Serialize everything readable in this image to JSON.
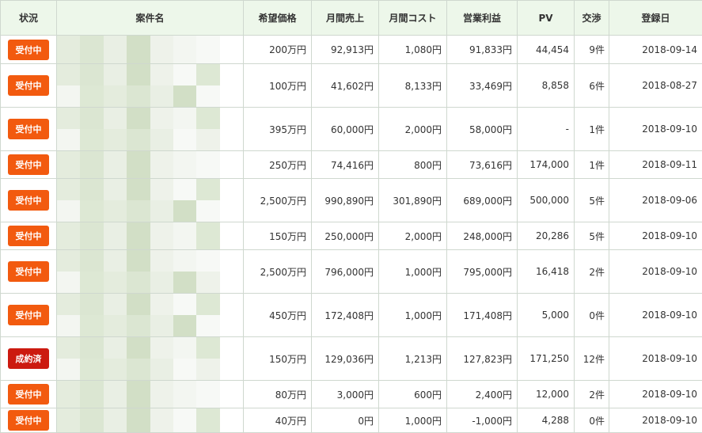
{
  "columns": [
    "状況",
    "案件名",
    "希望価格",
    "月間売上",
    "月間コスト",
    "営業利益",
    "PV",
    "交渉",
    "登録日"
  ],
  "colors": {
    "header_bg": "#edf7ea",
    "grid": "#cfd8cf",
    "status_open": "#f25a0f",
    "status_closed": "#cc1a10"
  },
  "rows": [
    {
      "status": "受付中",
      "status_type": "open",
      "price": "200万円",
      "sales": "92,913円",
      "cost": "1,080円",
      "profit": "91,833円",
      "pv": "44,454",
      "negotiations": "9件",
      "date": "2018-09-14"
    },
    {
      "status": "受付中",
      "status_type": "open",
      "price": "100万円",
      "sales": "41,602円",
      "cost": "8,133円",
      "profit": "33,469円",
      "pv": "8,858",
      "negotiations": "6件",
      "date": "2018-08-27"
    },
    {
      "status": "受付中",
      "status_type": "open",
      "price": "395万円",
      "sales": "60,000円",
      "cost": "2,000円",
      "profit": "58,000円",
      "pv": "-",
      "negotiations": "1件",
      "date": "2018-09-10"
    },
    {
      "status": "受付中",
      "status_type": "open",
      "price": "250万円",
      "sales": "74,416円",
      "cost": "800円",
      "profit": "73,616円",
      "pv": "174,000",
      "negotiations": "1件",
      "date": "2018-09-11"
    },
    {
      "status": "受付中",
      "status_type": "open",
      "price": "2,500万円",
      "sales": "990,890円",
      "cost": "301,890円",
      "profit": "689,000円",
      "pv": "500,000",
      "negotiations": "5件",
      "date": "2018-09-06"
    },
    {
      "status": "受付中",
      "status_type": "open",
      "price": "150万円",
      "sales": "250,000円",
      "cost": "2,000円",
      "profit": "248,000円",
      "pv": "20,286",
      "negotiations": "5件",
      "date": "2018-09-10"
    },
    {
      "status": "受付中",
      "status_type": "open",
      "price": "2,500万円",
      "sales": "796,000円",
      "cost": "1,000円",
      "profit": "795,000円",
      "pv": "16,418",
      "negotiations": "2件",
      "date": "2018-09-10"
    },
    {
      "status": "受付中",
      "status_type": "open",
      "price": "450万円",
      "sales": "172,408円",
      "cost": "1,000円",
      "profit": "171,408円",
      "pv": "5,000",
      "negotiations": "0件",
      "date": "2018-09-10"
    },
    {
      "status": "成約済",
      "status_type": "closed",
      "price": "150万円",
      "sales": "129,036円",
      "cost": "1,213円",
      "profit": "127,823円",
      "pv": "171,250",
      "negotiations": "12件",
      "date": "2018-09-10"
    },
    {
      "status": "受付中",
      "status_type": "open",
      "price": "80万円",
      "sales": "3,000円",
      "cost": "600円",
      "profit": "2,400円",
      "pv": "12,000",
      "negotiations": "2件",
      "date": "2018-09-10"
    },
    {
      "status": "受付中",
      "status_type": "open",
      "price": "40万円",
      "sales": "0円",
      "cost": "1,000円",
      "profit": "-1,000円",
      "pv": "4,288",
      "negotiations": "0件",
      "date": "2018-09-10"
    }
  ]
}
